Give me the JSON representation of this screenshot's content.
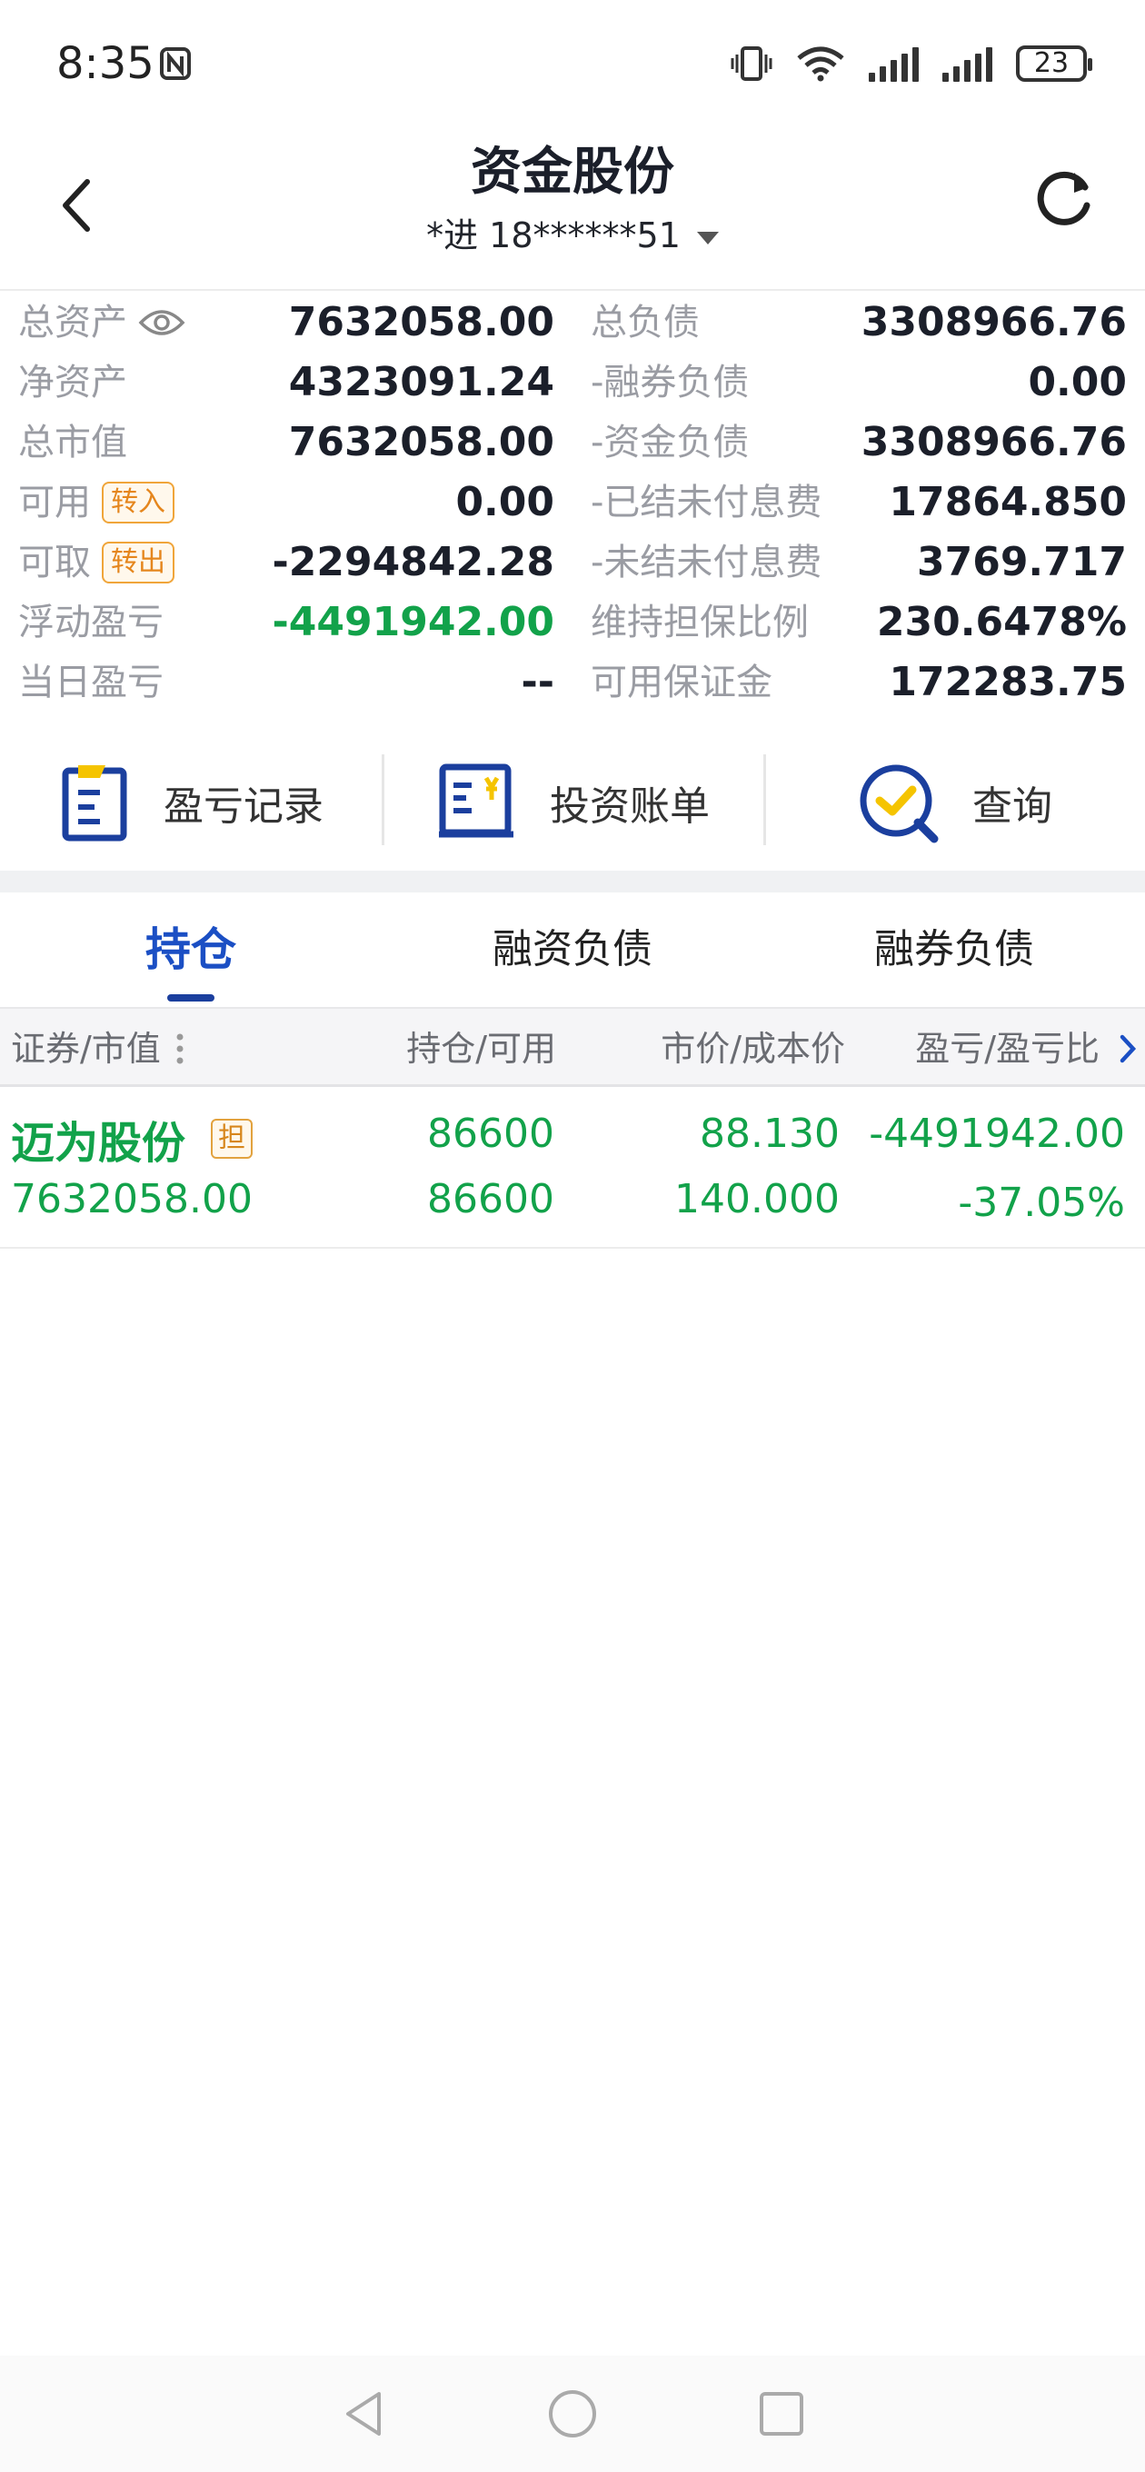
{
  "status": {
    "time": "8:35",
    "battery": "23"
  },
  "header": {
    "title": "资金股份",
    "account": "*进 18******51"
  },
  "summary": {
    "left": [
      {
        "label": "总资产",
        "value": "7632058.00"
      },
      {
        "label": "净资产",
        "value": "4323091.24"
      },
      {
        "label": "总市值",
        "value": "7632058.00"
      },
      {
        "label": "可用",
        "tag": "转入",
        "value": "0.00"
      },
      {
        "label": "可取",
        "tag": "转出",
        "value": "-2294842.28"
      },
      {
        "label": "浮动盈亏",
        "value": "-4491942.00"
      },
      {
        "label": "当日盈亏",
        "value": "--"
      }
    ],
    "right": [
      {
        "label": "总负债",
        "value": "3308966.76"
      },
      {
        "label": "-融券负债",
        "value": "0.00"
      },
      {
        "label": "-资金负债",
        "value": "3308966.76"
      },
      {
        "label": "-已结未付息费",
        "value": "17864.850"
      },
      {
        "label": "-未结未付息费",
        "value": "3769.717"
      },
      {
        "label": "维持担保比例",
        "value": "230.6478%"
      },
      {
        "label": "可用保证金",
        "value": "172283.75"
      }
    ]
  },
  "actions": [
    {
      "label": "盈亏记录",
      "icon": "record-icon"
    },
    {
      "label": "投资账单",
      "icon": "bill-icon"
    },
    {
      "label": "查询",
      "icon": "query-icon"
    }
  ],
  "tabs": [
    "持仓",
    "融资负债",
    "融券负债"
  ],
  "table": {
    "headers": [
      "证券/市值",
      "持仓/可用",
      "市价/成本价",
      "盈亏/盈亏比"
    ],
    "rows": [
      {
        "name": "迈为股份",
        "tag": "担",
        "market_value": "7632058.00",
        "position": "86600",
        "available": "86600",
        "price": "88.130",
        "cost": "140.000",
        "pl": "-4491942.00",
        "pl_ratio": "-37.05%"
      }
    ]
  },
  "colors": {
    "accent": "#1b4fc4",
    "loss": "#12a24a",
    "tag": "#e5861d",
    "icon_yellow": "#f5c400"
  }
}
